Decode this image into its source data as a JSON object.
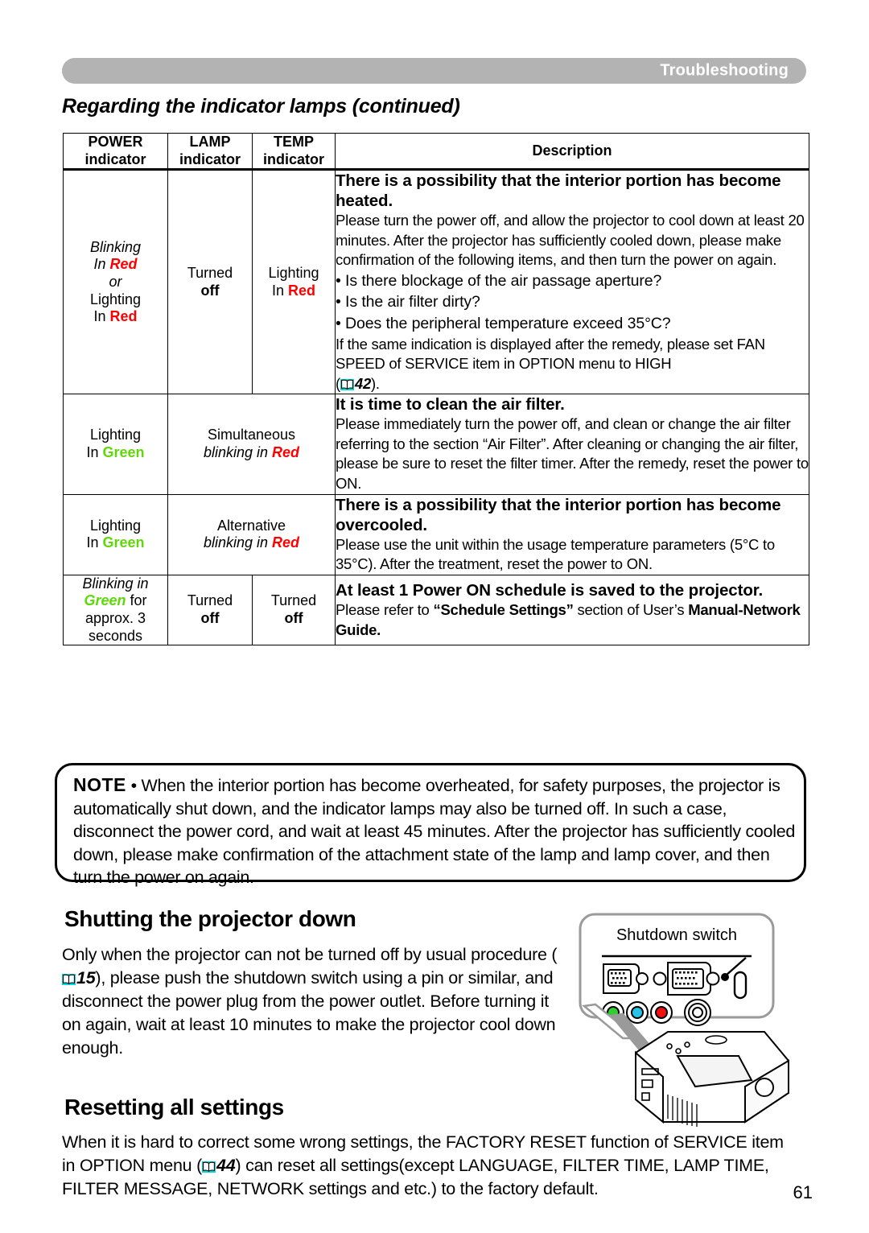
{
  "header": {
    "section_label": "Troubleshooting",
    "page_heading": "Regarding the indicator lamps (continued)"
  },
  "table": {
    "columns": [
      {
        "line1": "POWER",
        "line2": "indicator"
      },
      {
        "line1": "LAMP",
        "line2": "indicator"
      },
      {
        "line1": "TEMP",
        "line2": "indicator"
      },
      {
        "line1": "Description",
        "line2": ""
      }
    ],
    "rows": [
      {
        "power": {
          "l1": "Blinking",
          "l2_pre": "In ",
          "l2_color": "Red",
          "l3": "or",
          "l4": "Lighting",
          "l5_pre": "In ",
          "l5_color": "Red"
        },
        "lamp": {
          "l1": "Turned",
          "l2": "off"
        },
        "temp": {
          "l1": "Lighting",
          "l2_pre": "In ",
          "l2_color": "Red"
        },
        "desc_title": "There is a possibility that the interior portion has become heated.",
        "desc_body": "Please turn the power off, and allow the projector to cool down at least 20 minutes. After the projector has sufficiently cooled down, please make confirmation of the following items, and then turn the power on again.",
        "bullets": [
          "• Is there blockage of the air passage aperture?",
          "• Is the air filter dirty?",
          "• Does the peripheral temperature exceed 35°C?"
        ],
        "desc_tail": "If the same indication is displayed after the remedy, please set FAN SPEED of SERVICE item in OPTION menu to HIGH",
        "page_ref": "42",
        "page_ref_prefix": "(",
        "page_ref_suffix": ")."
      },
      {
        "power": {
          "l1": "Lighting",
          "l2_pre": "In ",
          "l2_color": "Green"
        },
        "lamp_temp": {
          "l1": "Simultaneous",
          "l2": "blinking in ",
          "l2_color": "Red"
        },
        "desc_title": "It is time to clean the air filter.",
        "desc_body": "Please immediately turn the power off, and clean or change the air filter referring to the section “Air Filter”. After cleaning or changing the air filter, please be sure to reset the filter timer. After the remedy, reset the power to ON."
      },
      {
        "power": {
          "l1": "Lighting",
          "l2_pre": "In ",
          "l2_color": "Green"
        },
        "lamp_temp": {
          "l1": "Alternative",
          "l2": "blinking in ",
          "l2_color": "Red"
        },
        "desc_title": "There is a possibility that the interior portion has become overcooled.",
        "desc_body": "Please use the unit within the usage temperature parameters (5°C to 35°C). After the treatment, reset the power to ON."
      },
      {
        "power": {
          "l1": "Blinking in",
          "l2_color": "Green",
          "l2_post": " for",
          "l3": "approx. 3",
          "l4": "seconds"
        },
        "lamp": {
          "l1": "Turned",
          "l2": "off"
        },
        "temp": {
          "l1": "Turned",
          "l2": "off"
        },
        "desc_title": "At least 1 Power ON schedule is saved to the projector.",
        "desc_body_pre": "Please refer to ",
        "desc_body_bold1": "“Schedule Settings”",
        "desc_body_mid": " section of User’s ",
        "desc_body_bold2": "Manual-Network Guide."
      }
    ]
  },
  "note": {
    "label": "NOTE",
    "text": "• When the interior portion has become overheated, for safety purposes, the projector is automatically shut down, and the indicator lamps may also be turned off. In such a case, disconnect the power cord, and wait at least 45 minutes. After the projector has sufficiently cooled down, please make confirmation of the attachment state of the lamp and lamp cover, and then turn the power on again."
  },
  "sections": {
    "shutdown": {
      "heading": "Shutting the projector down",
      "para_pre": "Only when the projector can not be turned off by usual procedure (",
      "page_ref": "15",
      "para_post": "), please push the shutdown switch using a pin or similar, and disconnect the power plug from the power outlet. Before turning it on again, wait at least 10 minutes to make the projector cool down enough."
    },
    "reset": {
      "heading": "Resetting all settings",
      "para_pre": "When it is hard to correct some wrong settings, the FACTORY RESET function of SERVICE item in OPTION menu (",
      "page_ref": "44",
      "para_post": ") can reset all settings(except LANGUAGE, FILTER TIME, LAMP TIME, FILTER MESSAGE, NETWORK settings and etc.) to the factory default."
    }
  },
  "illustration": {
    "callout_label": "Shutdown switch"
  },
  "page_number": "61",
  "colors": {
    "red": "#ff0000",
    "green": "#5fd80a",
    "book_icon": "#00d9d9",
    "banner": "#b3b3b3"
  }
}
